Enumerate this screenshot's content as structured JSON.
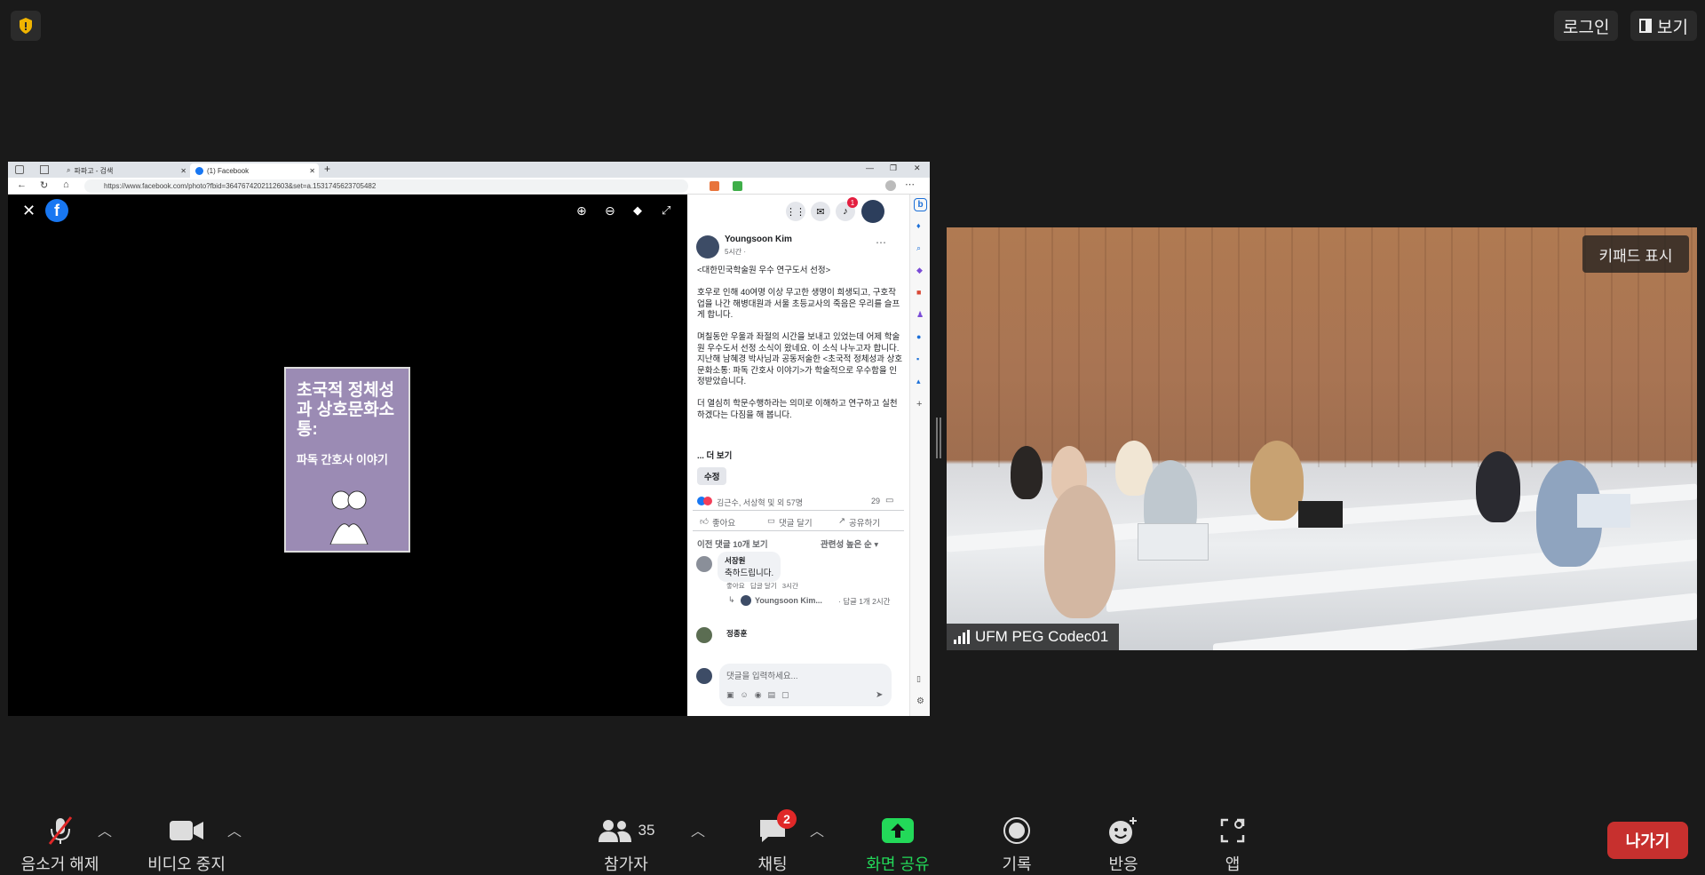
{
  "top": {
    "login_label": "로그인",
    "view_label": "보기"
  },
  "browser": {
    "tabs": [
      {
        "label": "파파고 - 검색"
      },
      {
        "label": "(1) Facebook"
      }
    ],
    "url": "https://www.facebook.com/photo?fbid=3647674202112603&set=a.1531745623705482"
  },
  "book": {
    "title": "초국적 정체성과 상호문화소통:",
    "subtitle": "파독 간호사 이야기"
  },
  "post": {
    "author": "Youngsoon Kim",
    "time": "5시간 ·",
    "text": "<대한민국학술원 우수 연구도서 선정>\n\n호우로 인해 40여명 이상 무고한 생명이 희생되고, 구호작업을 나간 해병대원과 서울 초등교사의 죽음은 우리를 슬프게 합니다.\n\n며칠동안 우울과 좌절의 시간을 보내고 있었는데 어제 학술원 우수도서 선정 소식이 왔네요. 이 소식 나누고자 합니다. 지난해 남혜경 박사님과 공동저술한 <초국적 정체성과 상호문화소통: 파독 간호사 이야기>가 학술적으로 우수함을 인정받았습니다.\n\n더 열심히 학문수행하라는 의미로 이해하고 연구하고 실천하겠다는 다짐을 해 봅니다.",
    "see_more": "... 더 보기",
    "edit_label": "수정",
    "reactions_text": "김근수, 서상혁 및 외 57명",
    "comment_count": "29",
    "like_label": "좋아요",
    "comment_label": "댓글 달기",
    "share_label": "공유하기",
    "prev_comments": "이전 댓글 10개 보기",
    "sort_label": "관련성 높은 순",
    "notif_count": "1",
    "comments": [
      {
        "author": "서장원",
        "text": "축하드립니다.",
        "actions": "좋아요   답글 달기   3시간",
        "reply_author": "Youngsoon Kim...",
        "reply_meta": "· 답글 1개 2시간"
      },
      {
        "author": "정종훈"
      }
    ],
    "comment_placeholder": "댓글을 입력하세요..."
  },
  "video": {
    "keypad_label": "키패드 표시",
    "participant_name": "UFM PEG Codec01"
  },
  "toolbar": {
    "mic_label": "음소거 해제",
    "video_label": "비디오 중지",
    "participants_label": "참가자",
    "participants_count": "35",
    "chat_label": "채팅",
    "chat_badge": "2",
    "share_label": "화면 공유",
    "record_label": "기록",
    "reactions_label": "반응",
    "apps_label": "앱",
    "leave_label": "나가기"
  },
  "colors": {
    "share_green": "#23d959",
    "leave_red": "#c7302e",
    "badge_red": "#e02828",
    "fb_blue": "#1877f2",
    "book_purple": "#9b8bb4"
  }
}
